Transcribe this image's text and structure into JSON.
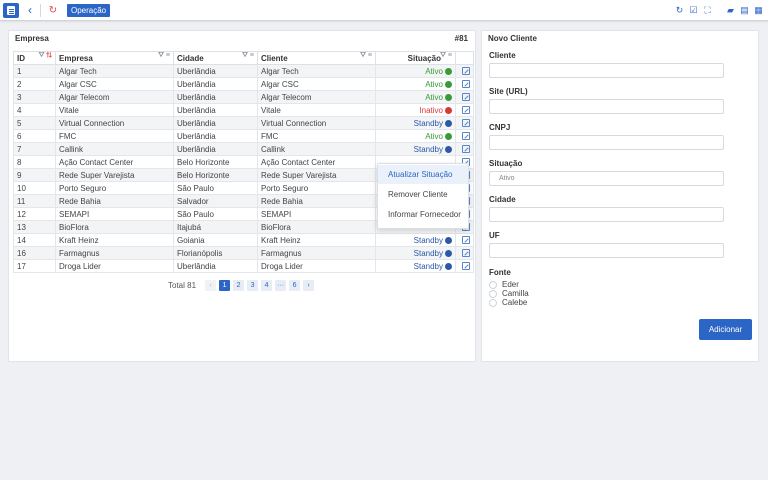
{
  "topbar": {
    "tab_label": "Operação",
    "back_glyph": "‹",
    "refresh_glyph": "↻",
    "tools": [
      "↻",
      "☑",
      "⛶",
      "▰",
      "▤",
      "▦"
    ]
  },
  "table_panel": {
    "title": "Empresa",
    "count": "#81",
    "columns": {
      "id": "ID",
      "empresa": "Empresa",
      "cidade": "Cidade",
      "cliente": "Cliente",
      "situacao": "Situação"
    },
    "rows": [
      {
        "id": "1",
        "empresa": "Algar Tech",
        "cidade": "Uberlândia",
        "cliente": "Algar Tech",
        "situacao": "Ativo",
        "status": "ativo"
      },
      {
        "id": "2",
        "empresa": "Algar CSC",
        "cidade": "Uberlândia",
        "cliente": "Algar CSC",
        "situacao": "Ativo",
        "status": "ativo"
      },
      {
        "id": "3",
        "empresa": "Algar Telecom",
        "cidade": "Uberlândia",
        "cliente": "Algar Telecom",
        "situacao": "Ativo",
        "status": "ativo"
      },
      {
        "id": "4",
        "empresa": "Vitale",
        "cidade": "Uberlândia",
        "cliente": "Vitale",
        "situacao": "Inativo",
        "status": "inativo"
      },
      {
        "id": "5",
        "empresa": "Virtual Connection",
        "cidade": "Uberlândia",
        "cliente": "Virtual Connection",
        "situacao": "Standby",
        "status": "standby"
      },
      {
        "id": "6",
        "empresa": "FMC",
        "cidade": "Uberlândia",
        "cliente": "FMC",
        "situacao": "Ativo",
        "status": "ativo"
      },
      {
        "id": "7",
        "empresa": "Callink",
        "cidade": "Uberlândia",
        "cliente": "Callink",
        "situacao": "Standby",
        "status": "standby"
      },
      {
        "id": "8",
        "empresa": "Ação Contact Center",
        "cidade": "Belo Horizonte",
        "cliente": "Ação Contact Center",
        "situacao": "",
        "status": ""
      },
      {
        "id": "9",
        "empresa": "Rede Super Varejista",
        "cidade": "Belo Horizonte",
        "cliente": "Rede Super Varejista",
        "situacao": "",
        "status": ""
      },
      {
        "id": "10",
        "empresa": "Porto Seguro",
        "cidade": "São Paulo",
        "cliente": "Porto Seguro",
        "situacao": "",
        "status": ""
      },
      {
        "id": "11",
        "empresa": "Rede Bahia",
        "cidade": "Salvador",
        "cliente": "Rede Bahia",
        "situacao": "",
        "status": ""
      },
      {
        "id": "12",
        "empresa": "SEMAPI",
        "cidade": "São Paulo",
        "cliente": "SEMAPI",
        "situacao": "",
        "status": ""
      },
      {
        "id": "13",
        "empresa": "BioFlora",
        "cidade": "Itajubá",
        "cliente": "BioFlora",
        "situacao": "",
        "status": ""
      },
      {
        "id": "14",
        "empresa": "Kraft Heinz",
        "cidade": "Goiania",
        "cliente": "Kraft Heinz",
        "situacao": "Standby",
        "status": "standby"
      },
      {
        "id": "16",
        "empresa": "Farmagnus",
        "cidade": "Florianópolis",
        "cliente": "Farmagnus",
        "situacao": "Standby",
        "status": "standby"
      },
      {
        "id": "17",
        "empresa": "Droga Lider",
        "cidade": "Uberlândia",
        "cliente": "Droga Lider",
        "situacao": "Standby",
        "status": "standby"
      }
    ],
    "status_colors": {
      "ativo": "#3a9a3a",
      "inativo": "#d83a3a",
      "standby": "#2b58a8"
    },
    "pagination": {
      "total_label": "Total 81",
      "pages": [
        "1",
        "2",
        "3",
        "4",
        "···",
        "6"
      ],
      "prev": "‹",
      "next": "›",
      "current": "1"
    }
  },
  "context_menu": {
    "items": [
      "Atualizar Situação",
      "Remover Cliente",
      "Informar Fornecedor"
    ]
  },
  "form": {
    "title": "Novo Cliente",
    "cliente_label": "Cliente",
    "site_label": "Site (URL)",
    "cnpj_label": "CNPJ",
    "situacao_label": "Situação",
    "situacao_placeholder": "Ativo",
    "cidade_label": "Cidade",
    "uf_label": "UF",
    "fonte_label": "Fonte",
    "fonte_options": [
      "Eder",
      "Camilla",
      "Calebe"
    ],
    "submit_label": "Adicionar"
  },
  "colors": {
    "accent": "#2b66c6"
  }
}
